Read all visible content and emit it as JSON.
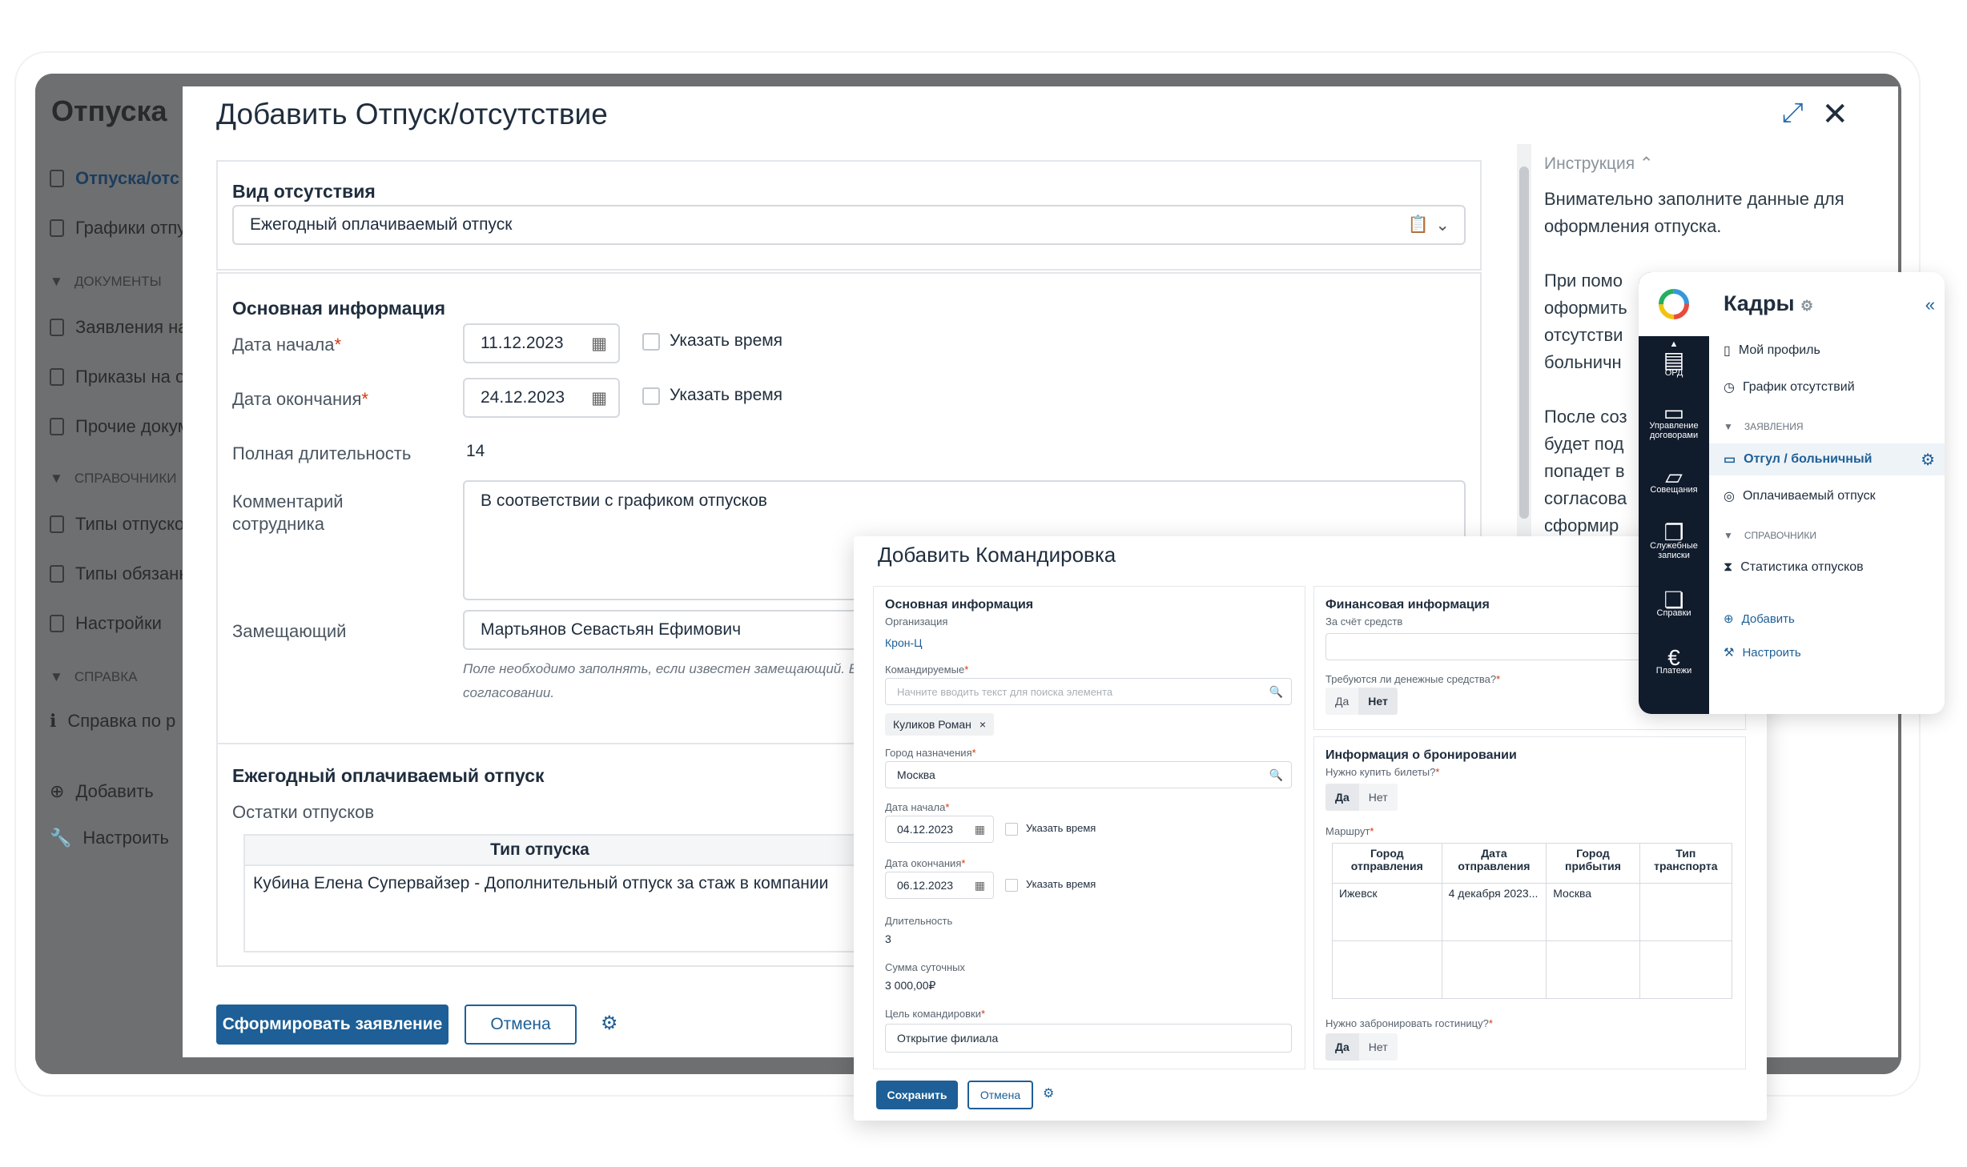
{
  "background_app": {
    "title": "Отпуска",
    "nav": [
      {
        "label": "Отпуска/отс",
        "active": true
      },
      {
        "label": "Графики отпу"
      },
      {
        "section": "ДОКУМЕНТЫ"
      },
      {
        "label": "Заявления на"
      },
      {
        "label": "Приказы на о"
      },
      {
        "label": "Прочие докум"
      },
      {
        "section": "СПРАВОЧНИКИ"
      },
      {
        "label": "Типы отпуско"
      },
      {
        "label": "Типы обязанн"
      },
      {
        "label": "Настройки"
      },
      {
        "section": "СПРАВКА"
      },
      {
        "label": "Справка по р"
      },
      {
        "label": "Добавить"
      },
      {
        "label": "Настроить"
      }
    ]
  },
  "vacation_modal": {
    "title": "Добавить Отпуск/отсутствие",
    "absence_type": {
      "label": "Вид отсутствия",
      "value": "Ежегодный оплачиваемый отпуск"
    },
    "main_info": {
      "heading": "Основная информация",
      "start_date": {
        "label": "Дата начала",
        "value": "11.12.2023",
        "time_label": "Указать время"
      },
      "end_date": {
        "label": "Дата окончания",
        "value": "24.12.2023",
        "time_label": "Указать время"
      },
      "duration": {
        "label": "Полная длительность",
        "value": "14"
      },
      "comment": {
        "label_1": "Комментарий",
        "label_2": "сотрудника",
        "value": "В соответствии с графиком отпусков"
      },
      "substitute": {
        "label": "Замещающий",
        "value": "Мартьянов Севастьян Ефимович",
        "hint_1": "Поле необходимо заполнять, если известен замещающий. Е",
        "hint_2": "согласовании."
      }
    },
    "annual": {
      "heading": "Ежегодный оплачиваемый отпуск",
      "subheading": "Остатки отпусков",
      "column": "Тип отпуска",
      "row": "Кубина Елена Супервайзер - Дополнительный отпуск за стаж в компании"
    },
    "instruction": {
      "toggle": "Инструкция",
      "p1": "Внимательно заполните данные для оформления отпуска.",
      "p2_lines": [
        "При помо",
        "оформить",
        "отсутстви",
        "больничн"
      ],
      "p3_lines": [
        "После соз",
        "будет под",
        "попадет в",
        "согласова",
        "сформир"
      ]
    },
    "submit_label": "Сформировать заявление",
    "cancel_label": "Отмена"
  },
  "trip_modal": {
    "title": "Добавить Командировка",
    "main": {
      "heading": "Основная информация",
      "org_label": "Организация",
      "org_value": "Крон-Ц",
      "travelers_label": "Командируемые",
      "travelers_placeholder": "Начните вводить текст для поиска элемента",
      "traveler_tag": "Куликов Роман",
      "city_label": "Город назначения",
      "city_value": "Москва",
      "start_label": "Дата начала",
      "start_value": "04.12.2023",
      "end_label": "Дата окончания",
      "end_value": "06.12.2023",
      "time_label": "Указать время",
      "duration_label": "Длительность",
      "duration_value": "3",
      "daily_label": "Сумма суточных",
      "daily_value": "3 000,00₽",
      "purpose_label": "Цель командировки",
      "purpose_value": "Открытие филиала"
    },
    "finance": {
      "heading": "Финансовая информация",
      "source_label": "За счёт средств",
      "money_label": "Требуются ли денежные средства?",
      "yes": "Да",
      "no": "Нет",
      "money_selected": "Нет"
    },
    "booking": {
      "heading": "Информация о бронировании",
      "tickets_label": "Нужно купить билеты?",
      "tickets_selected": "Да",
      "route_label": "Маршрут",
      "columns": [
        "Город отправления",
        "Дата отправления",
        "Город прибытия",
        "Тип транспорта"
      ],
      "rows": [
        [
          "Ижевск",
          "4 декабря 2023...",
          "Москва",
          ""
        ]
      ],
      "hotel_label": "Нужно забронировать гостиницу?",
      "hotel_selected": "Да"
    },
    "save_label": "Сохранить",
    "cancel_label": "Отмена"
  },
  "hr_sidebar": {
    "title": "Кадры",
    "rail": [
      {
        "icon": "document-icon",
        "label": "ОРД"
      },
      {
        "icon": "briefcase-icon",
        "label": "Управление договорами"
      },
      {
        "icon": "chat-icon",
        "label": "Совещания"
      },
      {
        "icon": "copy-icon",
        "label": "Служебные записки"
      },
      {
        "icon": "pages-icon",
        "label": "Справки"
      },
      {
        "icon": "euro-icon",
        "label": "Платежи"
      }
    ],
    "items": [
      {
        "label": "Мой профиль"
      },
      {
        "label": "График отсутствий"
      },
      {
        "section": "ЗАЯВЛЕНИЯ"
      },
      {
        "label": "Отгул / больничный",
        "active": true
      },
      {
        "label": "Оплачиваемый отпуск"
      },
      {
        "section": "СПРАВОЧНИКИ"
      },
      {
        "label": "Статистика отпусков"
      },
      {
        "label": "Добавить"
      },
      {
        "label": "Настроить"
      }
    ]
  },
  "colors": {
    "primary": "#1d5f96",
    "required": "#d4380d",
    "rail": "#101b2c",
    "overlay": "#6e6f71"
  }
}
